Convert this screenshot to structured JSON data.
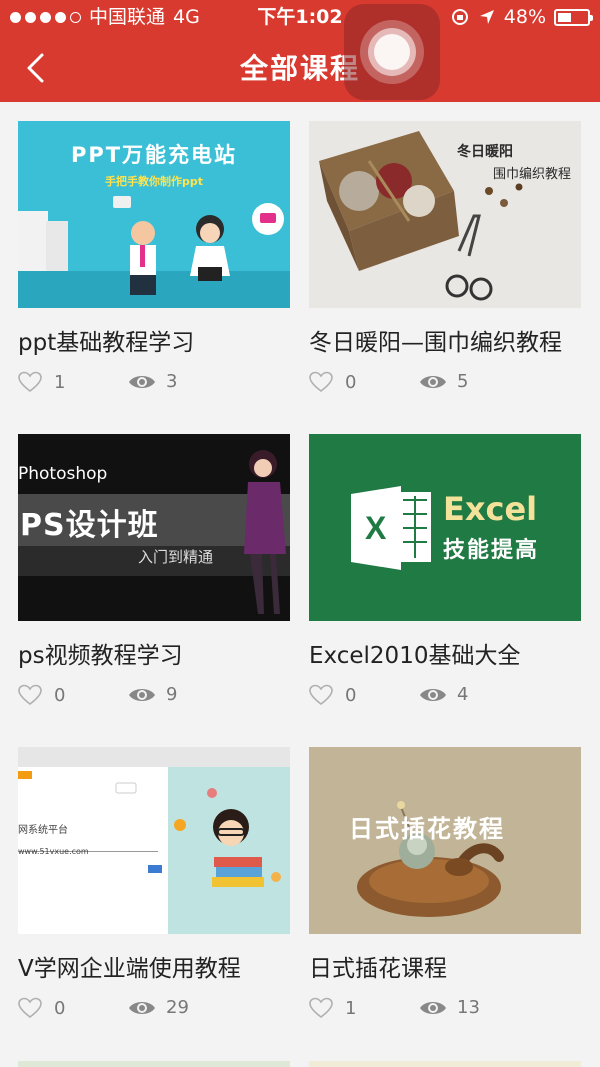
{
  "status": {
    "carrier": "中国联通",
    "network": "4G",
    "time": "下午1:02",
    "battery": "48%",
    "battery_level": 0.48
  },
  "header": {
    "title": "全部课程",
    "back_icon": "chevron-left-icon"
  },
  "courses": [
    {
      "title": "ppt基础教程学习",
      "likes": "1",
      "views": "3",
      "thumb_title": "PPT万能充电站",
      "thumb_sub": "手把手教你制作ppt"
    },
    {
      "title": "冬日暖阳—围巾编织教程",
      "likes": "0",
      "views": "5",
      "thumb_title": "冬日暖阳",
      "thumb_sub": "围巾编织教程"
    },
    {
      "title": "ps视频教程学习",
      "likes": "0",
      "views": "9",
      "thumb_brand": "Photoshop",
      "thumb_title": "PS设计班",
      "thumb_sub": "入门到精通"
    },
    {
      "title": "Excel2010基础大全",
      "likes": "0",
      "views": "4",
      "thumb_brand": "Excel",
      "thumb_sub": "技能提高"
    },
    {
      "title": "V学网企业端使用教程",
      "likes": "0",
      "views": "29",
      "thumb_sub": "网系统平台",
      "thumb_url": "www.51vxue.com"
    },
    {
      "title": "日式插花课程",
      "likes": "1",
      "views": "13",
      "thumb_title": "日式插花教程"
    }
  ],
  "icons": {
    "like": "heart-outline-icon",
    "views": "eye-icon"
  },
  "colors": {
    "brand_red": "#d93a2f",
    "excel_green": "#1f7a44"
  }
}
